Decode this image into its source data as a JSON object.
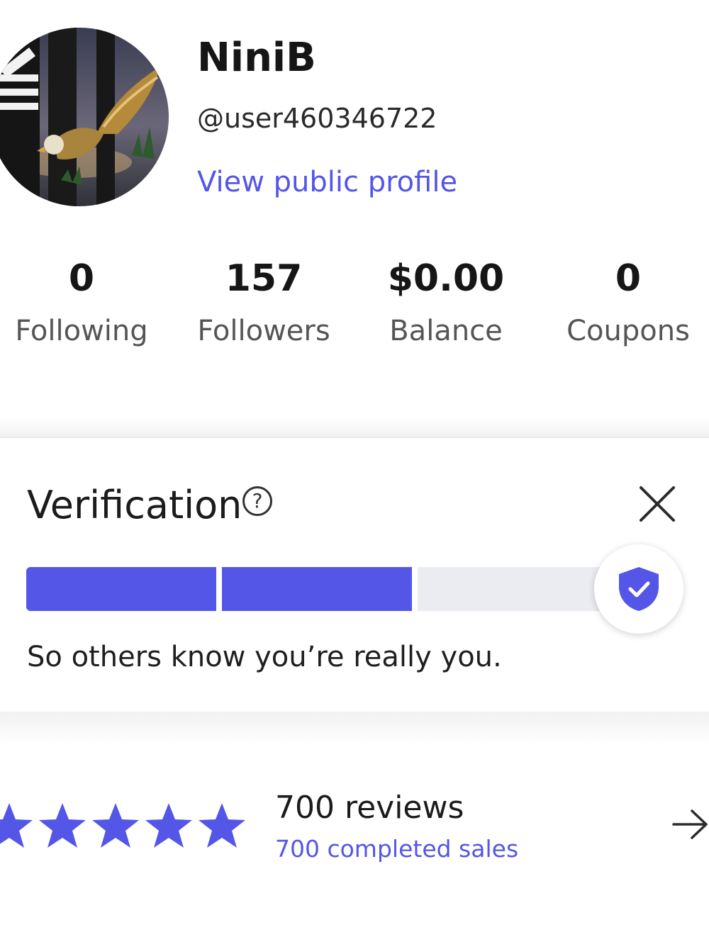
{
  "profile": {
    "name": "NiniB",
    "handle": "@user460346722",
    "view_public_profile": "View public profile",
    "avatar_icon": "eagle-avatar"
  },
  "stats": [
    {
      "value": "0",
      "label": "Following"
    },
    {
      "value": "157",
      "label": "Followers"
    },
    {
      "value": "$0.00",
      "label": "Balance"
    },
    {
      "value": "0",
      "label": "Coupons"
    }
  ],
  "verification": {
    "title": "Verification",
    "help_icon": "?",
    "description": "So others know you’re really you.",
    "steps_total": 3,
    "steps_completed": 2,
    "badge_icon": "shield-check-icon",
    "close_icon": "close-icon"
  },
  "reviews": {
    "rating_stars": 5,
    "reviews_label": "700 reviews",
    "sales_label": "700 completed sales",
    "arrow_icon": "arrow-right-icon"
  },
  "colors": {
    "accent": "#5456e8",
    "track": "#ebecf1",
    "text": "#1b1b1b",
    "muted": "#555555"
  }
}
